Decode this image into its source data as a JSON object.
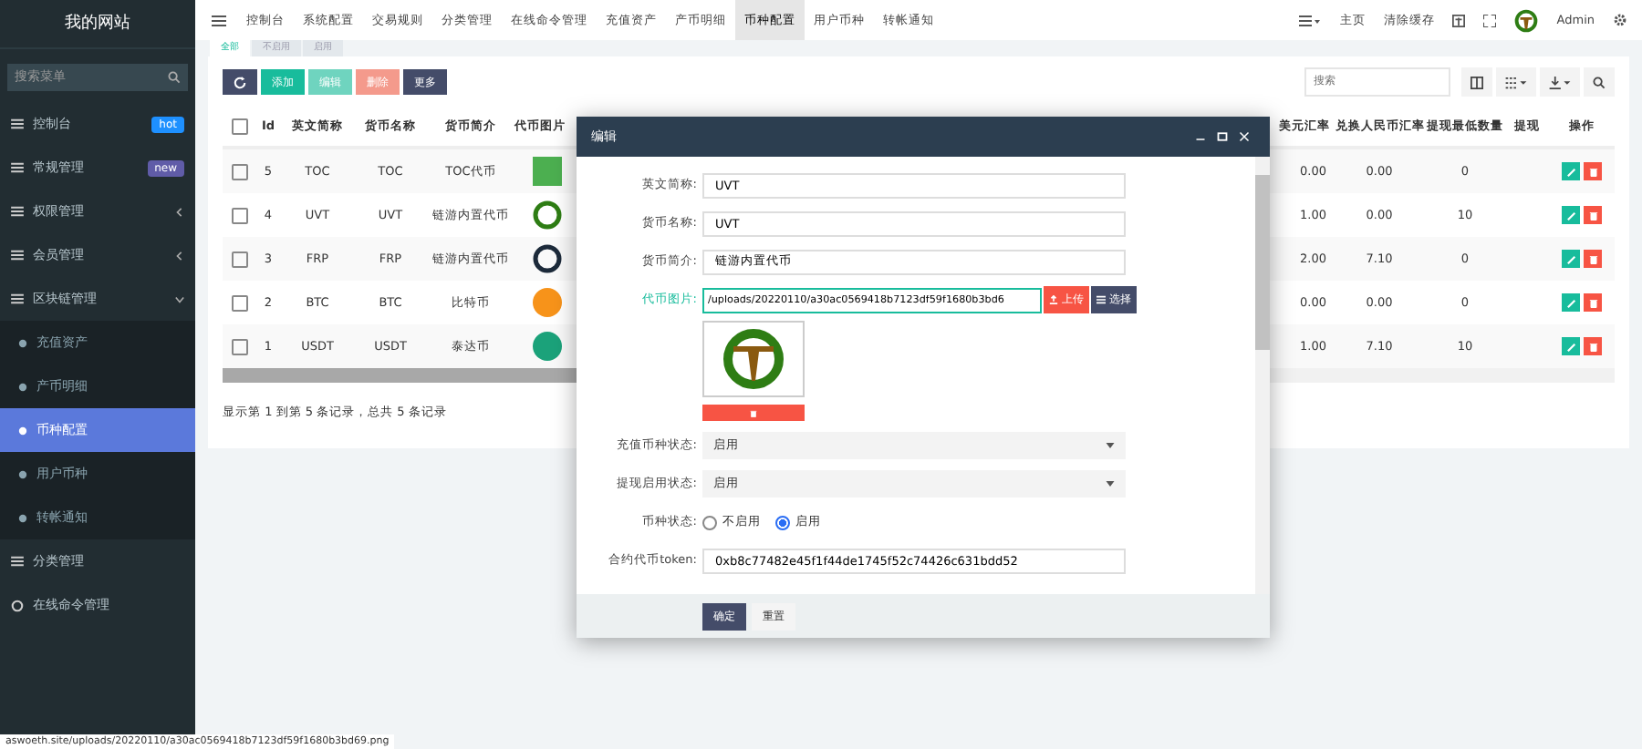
{
  "sidebar": {
    "logo": "我的网站",
    "search": {
      "placeholder": "搜索菜单"
    },
    "items": [
      {
        "label": "控制台",
        "badge": "hot",
        "color": "#1e90ff",
        "selected": false
      },
      {
        "label": "常规管理",
        "badge": "new",
        "color": "#605ca8",
        "selected": false
      },
      {
        "label": "权限管理",
        "expanded": false,
        "selected": false
      },
      {
        "label": "会员管理",
        "expanded": false,
        "selected": false
      },
      {
        "label": "区块链管理",
        "expanded": true,
        "selected": false,
        "children": [
          {
            "label": "充值资产",
            "selected": false
          },
          {
            "label": "产币明细",
            "selected": false
          },
          {
            "label": "币种配置",
            "selected": true
          },
          {
            "label": "用户币种",
            "selected": false
          },
          {
            "label": "转帐通知",
            "selected": false
          }
        ]
      },
      {
        "label": "分类管理",
        "selected": false
      },
      {
        "label": "在线命令管理",
        "selected": false
      }
    ]
  },
  "topnav": {
    "tabs": [
      {
        "label": "控制台",
        "selected": false
      },
      {
        "label": "系统配置",
        "selected": false
      },
      {
        "label": "交易规则",
        "selected": false
      },
      {
        "label": "分类管理",
        "selected": false
      },
      {
        "label": "在线命令管理",
        "selected": false
      },
      {
        "label": "充值资产",
        "selected": false
      },
      {
        "label": "产币明细",
        "selected": false
      },
      {
        "label": "币种配置",
        "selected": true
      },
      {
        "label": "用户币种",
        "selected": false
      },
      {
        "label": "转帐通知",
        "selected": false
      }
    ],
    "home": "主页",
    "clear_cache": "清除缓存",
    "user": "Admin"
  },
  "filter_tabs": [
    {
      "label": "全部",
      "selected": true
    },
    {
      "label": "不启用",
      "selected": false
    },
    {
      "label": "启用",
      "selected": false
    }
  ],
  "toolbar": {
    "buttons": [
      "添加",
      "编辑",
      "删除",
      "更多"
    ],
    "search_placeholder": "搜索"
  },
  "table": {
    "all_checked": false,
    "columns": [
      "Id",
      "英文简称",
      "货币名称",
      "货币简介",
      "代币图片",
      "美元汇率",
      "兑换人民币汇率",
      "提现最低数量",
      "提现",
      "操作"
    ],
    "rows": [
      {
        "id": "5",
        "en": "TOC",
        "name": "TOC",
        "intro": "TOC代币",
        "kind": "square",
        "color": "#4caf50",
        "usd": "0.00",
        "cny": "0.00",
        "min": "0",
        "checked": false
      },
      {
        "id": "4",
        "en": "UVT",
        "name": "UVT",
        "intro": "链游内置代币",
        "kind": "ring",
        "color": "#2e7d14",
        "usd": "1.00",
        "cny": "0.00",
        "min": "10",
        "checked": false
      },
      {
        "id": "3",
        "en": "FRP",
        "name": "FRP",
        "intro": "链游内置代币",
        "kind": "ring",
        "color": "#1c2a3a",
        "usd": "2.00",
        "cny": "7.10",
        "min": "0",
        "checked": false
      },
      {
        "id": "2",
        "en": "BTC",
        "name": "BTC",
        "intro": "比特币",
        "kind": "circle",
        "color": "#f7931a",
        "usd": "0.00",
        "cny": "0.00",
        "min": "0",
        "checked": false
      },
      {
        "id": "1",
        "en": "USDT",
        "name": "USDT",
        "intro": "泰达币",
        "kind": "circle",
        "color": "#1ba27a",
        "usd": "1.00",
        "cny": "7.10",
        "min": "10",
        "checked": false
      }
    ],
    "footer": "显示第 1 到第 5 条记录，总共 5 条记录"
  },
  "modal": {
    "title": "编辑",
    "fields": [
      {
        "kind": "text",
        "label": "英文简称:",
        "value": "UVT"
      },
      {
        "kind": "text",
        "label": "货币名称:",
        "value": "UVT"
      },
      {
        "kind": "text",
        "label": "货币简介:",
        "value": "链游内置代币"
      },
      {
        "kind": "upload",
        "label": "代币图片:",
        "value": "/uploads/20220110/a30ac0569418b7123df59f1680b3bd6",
        "upload": "上传",
        "choose": "选择"
      },
      {
        "kind": "select",
        "label": "充值币种状态:",
        "value": "启用"
      },
      {
        "kind": "select",
        "label": "提现启用状态:",
        "value": "启用"
      },
      {
        "kind": "radio",
        "label": "币种状态:",
        "options": [
          {
            "label": "不启用",
            "selected": false
          },
          {
            "label": "启用",
            "selected": true
          }
        ]
      },
      {
        "kind": "text",
        "label": "合约代币token:",
        "value": "0xb8c77482e45f1f44de1745f52c74426c631bdd52"
      }
    ],
    "buttons": [
      "确定",
      "重置"
    ]
  },
  "status_url": "aswoeth.site/uploads/20220110/a30ac0569418b7123df59f1680b3bd69.png"
}
